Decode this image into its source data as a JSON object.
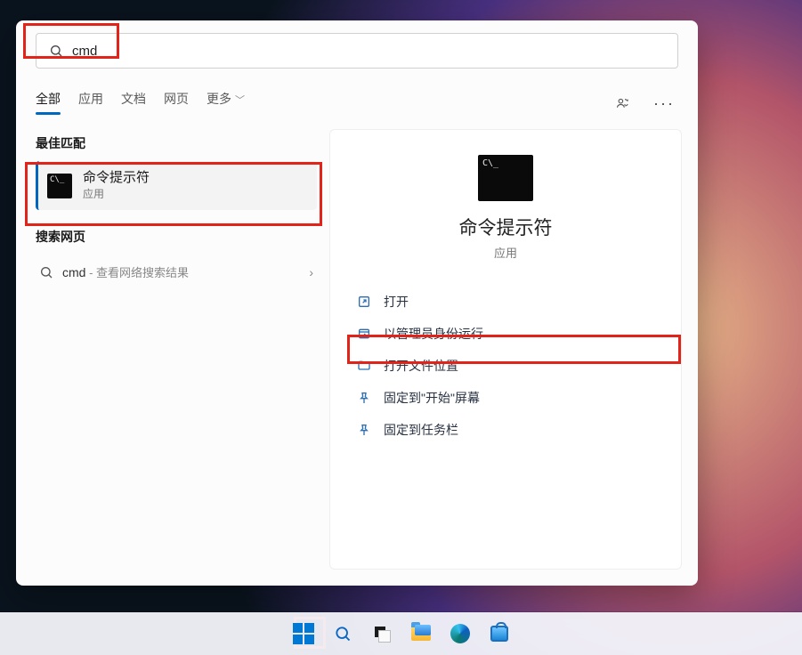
{
  "search": {
    "query": "cmd",
    "placeholder": ""
  },
  "tabs": {
    "items": [
      "全部",
      "应用",
      "文档",
      "网页"
    ],
    "more": "更多",
    "active_index": 0
  },
  "left": {
    "best_match_header": "最佳匹配",
    "best_match": {
      "title": "命令提示符",
      "subtitle": "应用"
    },
    "web_header": "搜索网页",
    "web_item": {
      "term": "cmd",
      "hint": " - 查看网络搜索结果"
    }
  },
  "detail": {
    "title": "命令提示符",
    "subtitle": "应用",
    "actions": [
      {
        "label": "打开",
        "icon": "open"
      },
      {
        "label": "以管理员身份运行",
        "icon": "admin"
      },
      {
        "label": "打开文件位置",
        "icon": "folder"
      },
      {
        "label": "固定到\"开始\"屏幕",
        "icon": "pin"
      },
      {
        "label": "固定到任务栏",
        "icon": "pin"
      }
    ]
  },
  "taskbar": {
    "items": [
      "start",
      "search",
      "taskview",
      "explorer",
      "edge",
      "store"
    ]
  }
}
